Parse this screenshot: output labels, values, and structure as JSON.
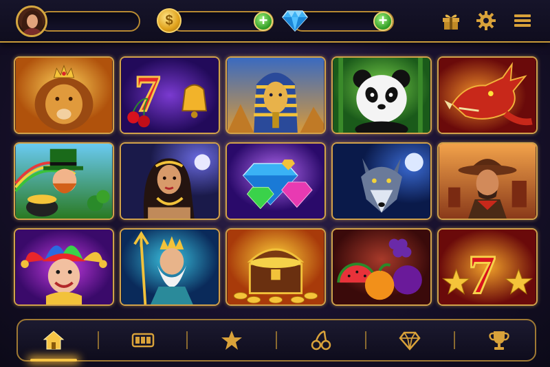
{
  "header": {
    "player_name": "",
    "coin_balance": "",
    "gem_balance": "",
    "coin_symbol": "$",
    "icons": [
      "avatar",
      "coin-icon",
      "add-coins-button",
      "gem-icon",
      "add-gems-button",
      "gift-icon",
      "gear-icon",
      "menu-icon"
    ]
  },
  "games": [
    {
      "id": "lion-king",
      "theme": "Lion with crown"
    },
    {
      "id": "lucky-sevens",
      "theme": "Red 7, cherries and bell"
    },
    {
      "id": "pharaoh",
      "theme": "Golden pharaoh"
    },
    {
      "id": "panda",
      "theme": "Panda in bamboo"
    },
    {
      "id": "dragon",
      "theme": "Red dragon"
    },
    {
      "id": "leprechaun",
      "theme": "Leprechaun with pot of gold"
    },
    {
      "id": "goddess",
      "theme": "Goddess with gold jewelry"
    },
    {
      "id": "diamonds",
      "theme": "Gems and diamonds"
    },
    {
      "id": "wolf",
      "theme": "Wolf under the moon"
    },
    {
      "id": "cowboy",
      "theme": "Cowboy in the desert"
    },
    {
      "id": "jester",
      "theme": "Jester"
    },
    {
      "id": "poseidon",
      "theme": "Poseidon with trident"
    },
    {
      "id": "treasure-chest",
      "theme": "Treasure chest of gold"
    },
    {
      "id": "fruits",
      "theme": "Watermelon, orange, plum, grapes"
    },
    {
      "id": "seven-stars",
      "theme": "Red 7 with gold stars"
    }
  ],
  "nav": {
    "items": [
      "home",
      "slots",
      "favorites",
      "classic",
      "premium",
      "tournaments"
    ],
    "active": "home"
  },
  "colors": {
    "accent_gold": "#d2a24a",
    "active_glow": "#f7c545",
    "plus_green": "#2e9a24"
  }
}
